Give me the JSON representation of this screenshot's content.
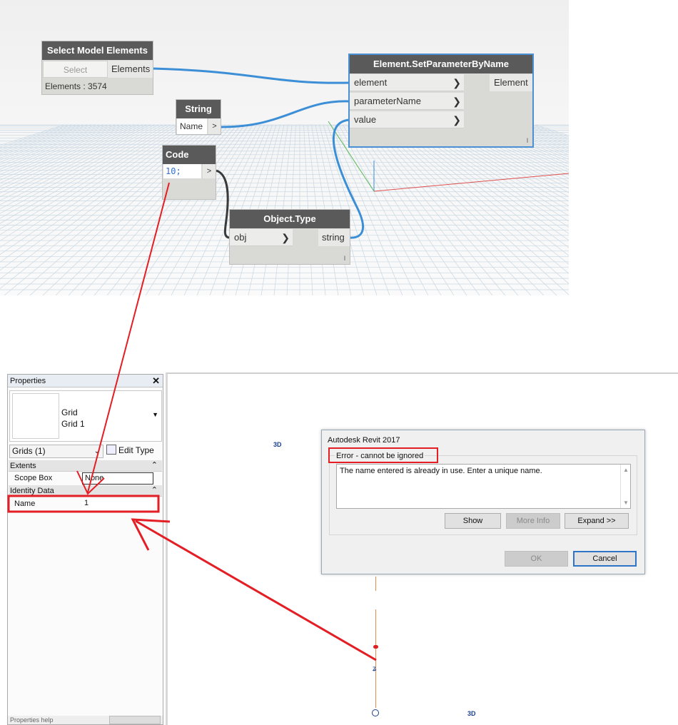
{
  "dynamo": {
    "nodes": {
      "select_model_elements": {
        "title": "Select Model Elements",
        "select_button": "Select",
        "output": "Elements",
        "info": "Elements : 3574"
      },
      "string": {
        "title": "String",
        "value": "Name",
        "output": ">"
      },
      "code_block": {
        "title": "Code Block",
        "code": "10;",
        "output": ">"
      },
      "object_type": {
        "title": "Object.Type",
        "input": "obj",
        "output": "string",
        "lacing": "l"
      },
      "set_parameter": {
        "title": "Element.SetParameterByName",
        "inputs": [
          "element",
          "parameterName",
          "value"
        ],
        "output": "Element",
        "lacing": "l"
      }
    },
    "colors": {
      "wire": "#3c8fd6",
      "node_header": "#5a5a5a",
      "selection": "#4a90d2"
    }
  },
  "properties": {
    "title": "Properties",
    "close": "✕",
    "type_family": "Grid",
    "type_name": "Grid 1",
    "selector": "Grids (1)",
    "edit_type": "Edit Type",
    "sections": [
      {
        "name": "Extents",
        "rows": [
          {
            "key": "Scope Box",
            "value": "None"
          }
        ]
      },
      {
        "name": "Identity Data",
        "rows": [
          {
            "key": "Name",
            "value": "1"
          }
        ]
      }
    ],
    "bottom_text": "Properties help"
  },
  "view": {
    "label_3d": "3D"
  },
  "dialog": {
    "title": "Autodesk Revit 2017",
    "error_label": "Error - cannot be ignored",
    "message": "The name entered is already in use. Enter a unique name.",
    "buttons": {
      "show": "Show",
      "more_info": "More Info",
      "expand": "Expand >>",
      "ok": "OK",
      "cancel": "Cancel"
    }
  },
  "annotation_color": "#e31e24"
}
